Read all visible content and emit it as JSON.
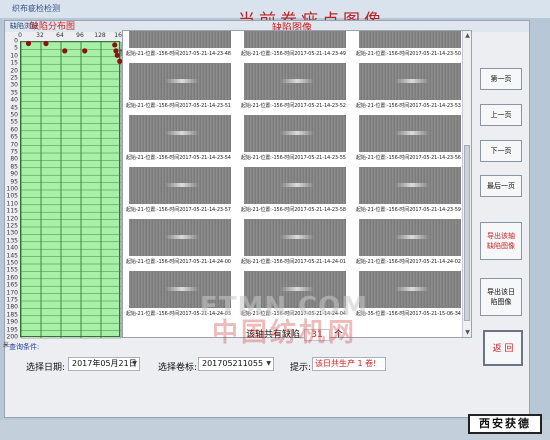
{
  "background": {
    "app_title": "织布疵检检测",
    "heading": "当前卷疵点图像"
  },
  "window": {
    "title": "缺陷浏览"
  },
  "defect_map": {
    "title": "缺陷分布图",
    "x_ticks": [
      "0",
      "32",
      "64",
      "96",
      "128",
      "160"
    ],
    "x_unit": "位置",
    "y_ticks": [
      "0",
      "5",
      "10",
      "15",
      "20",
      "25",
      "30",
      "35",
      "40",
      "45",
      "50",
      "55",
      "60",
      "65",
      "70",
      "75",
      "80",
      "85",
      "90",
      "95",
      "100",
      "105",
      "110",
      "115",
      "120",
      "125",
      "130",
      "135",
      "140",
      "145",
      "150",
      "155",
      "160",
      "165",
      "170",
      "175",
      "180",
      "185",
      "190",
      "195",
      "200"
    ],
    "y_unit": "米",
    "grid_color": "#a8f0a8",
    "marker_color": "#8b1010",
    "points": [
      {
        "pos": 12,
        "m": 1
      },
      {
        "pos": 40,
        "m": 1
      },
      {
        "pos": 70,
        "m": 6
      },
      {
        "pos": 102,
        "m": 6
      },
      {
        "pos": 150,
        "m": 2
      },
      {
        "pos": 152,
        "m": 6
      },
      {
        "pos": 154,
        "m": 9
      },
      {
        "pos": 158,
        "m": 13
      }
    ]
  },
  "images_panel": {
    "title": "缺陷图像",
    "thumbnails": [
      {
        "caption": "起始-21-位置:-156-时间2017-05-21-14-23-48"
      },
      {
        "caption": "起始-21-位置:-156-时间2017-05-21-14-23-49"
      },
      {
        "caption": "起始-21-位置:-156-时间2017-05-21-14-23-50"
      },
      {
        "caption": "起始-21-位置:-156-时间2017-05-21-14-23-51"
      },
      {
        "caption": "起始-21-位置:-156-时间2017-05-21-14-23-52"
      },
      {
        "caption": "起始-21-位置:-156-时间2017-05-21-14-23-53"
      },
      {
        "caption": "起始-21-位置:-156-时间2017-05-21-14-23-54"
      },
      {
        "caption": "起始-21-位置:-156-时间2017-05-21-14-23-55"
      },
      {
        "caption": "起始-21-位置:-156-时间2017-05-21-14-23-56"
      },
      {
        "caption": "起始-21-位置:-156-时间2017-05-21-14-23-57"
      },
      {
        "caption": "起始-21-位置:-156-时间2017-05-21-14-23-58"
      },
      {
        "caption": "起始-21-位置:-156-时间2017-05-21-14-23-59"
      },
      {
        "caption": "起始-21-位置:-156-时间2017-05-21-14-24-00"
      },
      {
        "caption": "起始-21-位置:-156-时间2017-05-21-14-24-01"
      },
      {
        "caption": "起始-21-位置:-156-时间2017-05-21-14-24-02"
      },
      {
        "caption": "起始-21-位置:-156-时间2017-05-21-14-24-03"
      },
      {
        "caption": "起始-21-位置:-156-时间2017-05-21-14-24-04"
      },
      {
        "caption": "起始-35-位置:-156-时间2017-05-21-15-06-34"
      }
    ],
    "scroll_up": "▲",
    "scroll_down": "▼"
  },
  "count": {
    "label": "该轴共有缺陷",
    "value": "31",
    "unit": "个"
  },
  "buttons": {
    "first": "第一页",
    "prev": "上一页",
    "next": "下一页",
    "last": "最后一页",
    "export_axis": "导出该轴缺陷图像",
    "export_day": "导出该日陷图像",
    "back": "返 回"
  },
  "query": {
    "section_label": "查询条件:",
    "date_label": "选择日期:",
    "date_value": "2017年05月21日",
    "axis_label": "选择卷标:",
    "axis_value": "201705211055",
    "hint_label": "提示:",
    "hint_value": "该日共生产 1 卷!"
  },
  "watermark": {
    "line1": "FTMN.COM",
    "line2": "中国纺机网"
  },
  "brand": "西安获德"
}
